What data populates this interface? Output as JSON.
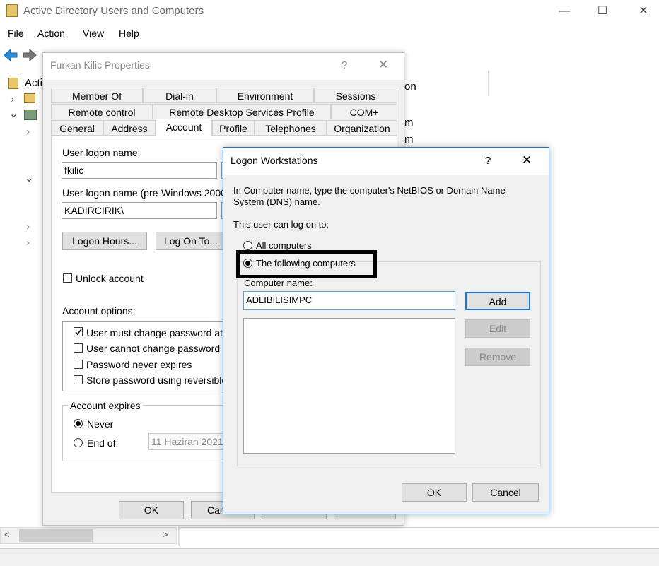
{
  "app": {
    "title": "Active Directory Users and Computers"
  },
  "window_controls": {
    "minimize": "—",
    "maximize": "☐",
    "close": "✕"
  },
  "menu": {
    "file": "File",
    "action": "Action",
    "view": "View",
    "help": "Help"
  },
  "tree": {
    "root_partial": "Acti",
    "right_col_partial": [
      "on",
      "m",
      "m"
    ]
  },
  "props": {
    "title": "Furkan Kilic Properties",
    "help": "?",
    "close": "✕",
    "tabs_row1": [
      "Member Of",
      "Dial-in",
      "Environment",
      "Sessions"
    ],
    "tabs_row2": [
      "Remote control",
      "Remote Desktop Services Profile",
      "COM+"
    ],
    "tabs_row3": [
      "General",
      "Address",
      "Account",
      "Profile",
      "Telephones",
      "Organization"
    ],
    "logon_name_label": "User logon name:",
    "logon_name_value": "fkilic",
    "pre2000_label": "User logon name (pre-Windows 2000):",
    "pre2000_value": "KADIRCIRIK\\",
    "logon_hours_button": "Logon Hours...",
    "log_on_to_button": "Log On To...",
    "unlock_label": "Unlock account",
    "account_options_label": "Account options:",
    "options": [
      "User must change password at n",
      "User cannot change password",
      "Password never expires",
      "Store password using reversible e"
    ],
    "expires_label": "Account expires",
    "never_label": "Never",
    "endof_label": "End of:",
    "date_value": "11  Haziran  2021",
    "ok_button": "OK",
    "cancel_partial": "Can"
  },
  "logon": {
    "title": "Logon Workstations",
    "help": "?",
    "close": "✕",
    "instruction": "In Computer name, type the computer's NetBIOS or Domain Name System (DNS) name.",
    "can_log_on": "This user can log on to:",
    "all_computers": "All computers",
    "following_computers": "The following computers",
    "computer_name_label": "Computer name:",
    "computer_name_value": "ADLIBILISIMPC",
    "add_button": "Add",
    "edit_button": "Edit",
    "remove_button": "Remove",
    "ok_button": "OK",
    "cancel_button": "Cancel"
  },
  "colors": {
    "accent": "#1e76c8",
    "disabled_text": "#8a8a8a",
    "folder": "#e8c66a"
  }
}
